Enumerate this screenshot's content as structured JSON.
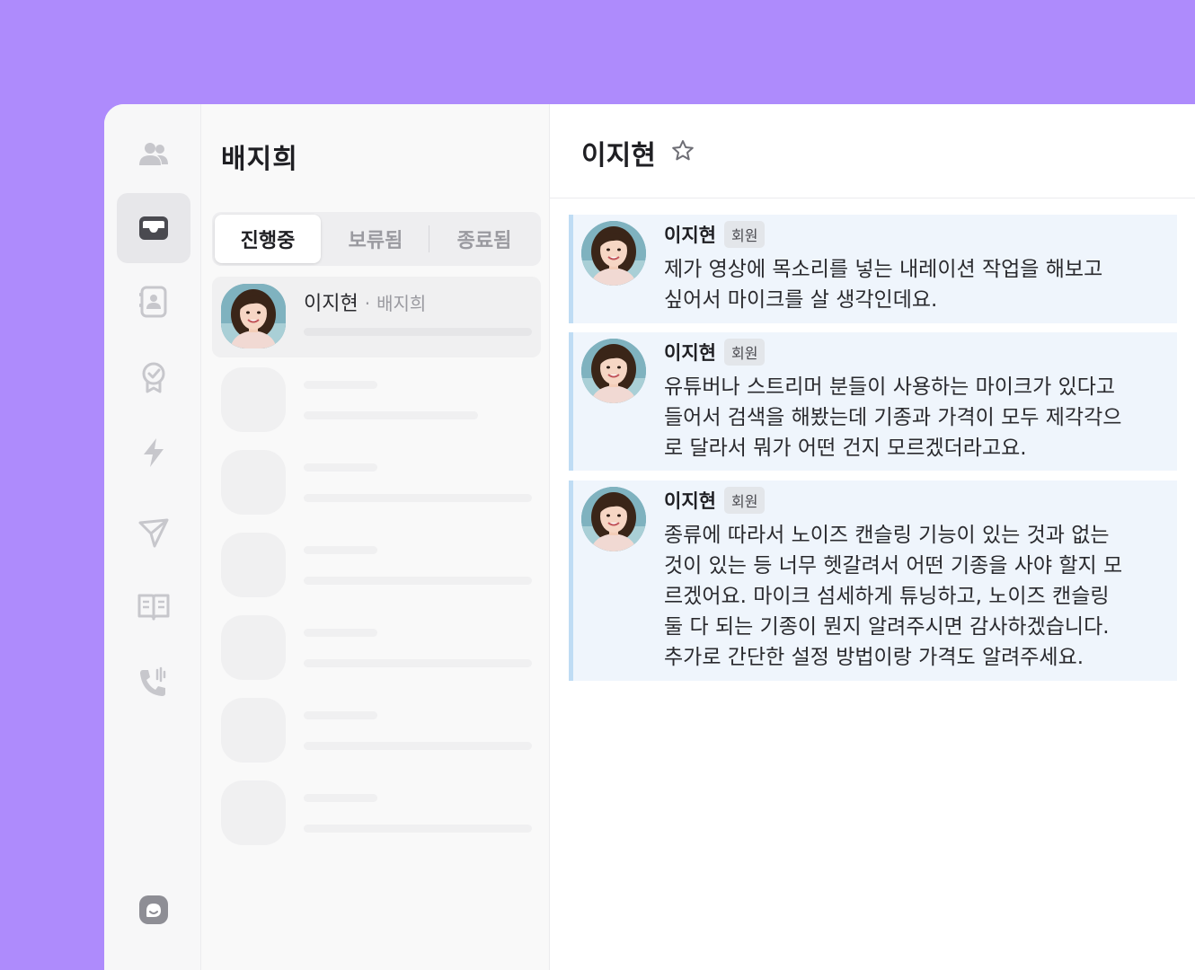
{
  "sidebar_title": "배지희",
  "tabs": [
    {
      "label": "진행중",
      "active": true
    },
    {
      "label": "보류됨",
      "active": false
    },
    {
      "label": "종료됨",
      "active": false
    }
  ],
  "conversation": {
    "name": "이지현",
    "separator": "·",
    "assignee": "배지희"
  },
  "chat": {
    "title": "이지현",
    "messages": [
      {
        "author": "이지현",
        "badge": "회원",
        "text": "제가 영상에 목소리를 넣는 내레이션 작업을 해보고\n싶어서 마이크를 살 생각인데요."
      },
      {
        "author": "이지현",
        "badge": "회원",
        "text": "유튜버나 스트리머 분들이 사용하는 마이크가 있다고\n들어서 검색을 해봤는데 기종과 가격이 모두 제각각으\n로 달라서 뭐가 어떤 건지 모르겠더라고요."
      },
      {
        "author": "이지현",
        "badge": "회원",
        "text": "종류에 따라서 노이즈 캔슬링 기능이 있는 것과 없는\n것이 있는 등 너무 헷갈려서 어떤 기종을 사야 할지 모\n르겠어요. 마이크 섬세하게 튜닝하고, 노이즈 캔슬링\n둘 다 되는 기종이 뭔지 알려주시면 감사하겠습니다.\n추가로 간단한 설정 방법이랑 가격도 알려주세요."
      }
    ]
  },
  "icons": [
    "users-icon",
    "inbox-icon",
    "contact-card-icon",
    "badge-check-icon",
    "bolt-icon",
    "send-icon",
    "book-icon",
    "phone-call-icon",
    "chat-bubble-icon",
    "star-icon"
  ],
  "colors": {
    "background": "#ae8bfc",
    "message_bg": "#eff5fc",
    "message_accent": "#bfdcf4",
    "icon_gray": "#c7c7cc"
  }
}
